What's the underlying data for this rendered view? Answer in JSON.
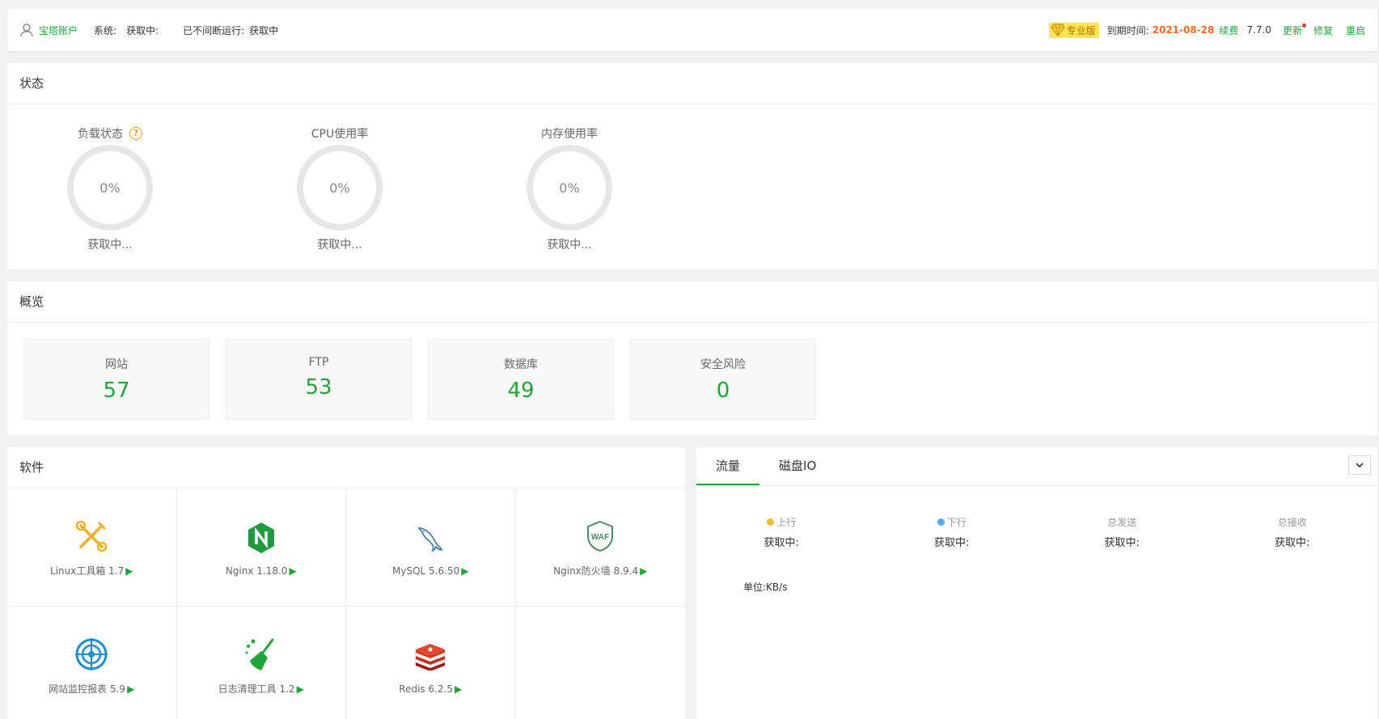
{
  "topbar": {
    "account_label": "宝塔账户",
    "system_label": "系统:",
    "system_value": "获取中:",
    "uptime_label": "已不间断运行:",
    "uptime_value": "获取中",
    "pro_badge": "专业版",
    "expire_label": "到期时间:",
    "expire_date": "2021-08-28",
    "renew": "续费",
    "version": "7.7.0",
    "update": "更新",
    "repair": "修复",
    "restart": "重启"
  },
  "status": {
    "title": "状态",
    "gauges": [
      {
        "title": "负载状态",
        "value": "0%",
        "sub": "获取中..."
      },
      {
        "title": "CPU使用率",
        "value": "0%",
        "sub": "获取中..."
      },
      {
        "title": "内存使用率",
        "value": "0%",
        "sub": "获取中..."
      }
    ]
  },
  "overview": {
    "title": "概览",
    "cards": [
      {
        "label": "网站",
        "value": "57"
      },
      {
        "label": "FTP",
        "value": "53"
      },
      {
        "label": "数据库",
        "value": "49"
      },
      {
        "label": "安全风险",
        "value": "0"
      }
    ]
  },
  "software": {
    "title": "软件",
    "items": [
      {
        "label": "Linux工具箱 1.7",
        "icon": "tools-icon"
      },
      {
        "label": "Nginx 1.18.0",
        "icon": "nginx-icon"
      },
      {
        "label": "MySQL 5.6.50",
        "icon": "mysql-dolphin-icon"
      },
      {
        "label": "Nginx防火墙 8.9.4",
        "icon": "waf-shield-icon"
      },
      {
        "label": "网站监控报表 5.9",
        "icon": "radar-target-icon"
      },
      {
        "label": "日志清理工具 1.2",
        "icon": "broom-icon"
      },
      {
        "label": "Redis 6.2.5",
        "icon": "redis-icon"
      }
    ]
  },
  "traffic": {
    "tabs": [
      "流量",
      "磁盘IO"
    ],
    "stats": [
      {
        "label": "上行",
        "value": "获取中:",
        "color": "#f0b93a"
      },
      {
        "label": "下行",
        "value": "获取中:",
        "color": "#52a9ff"
      },
      {
        "label": "总发送",
        "value": "获取中:"
      },
      {
        "label": "总接收",
        "value": "获取中:"
      }
    ],
    "unit": "单位:KB/s"
  },
  "colors": {
    "accent": "#20a53a",
    "orange": "#ef6d2a",
    "badge": "#ffe64f"
  }
}
